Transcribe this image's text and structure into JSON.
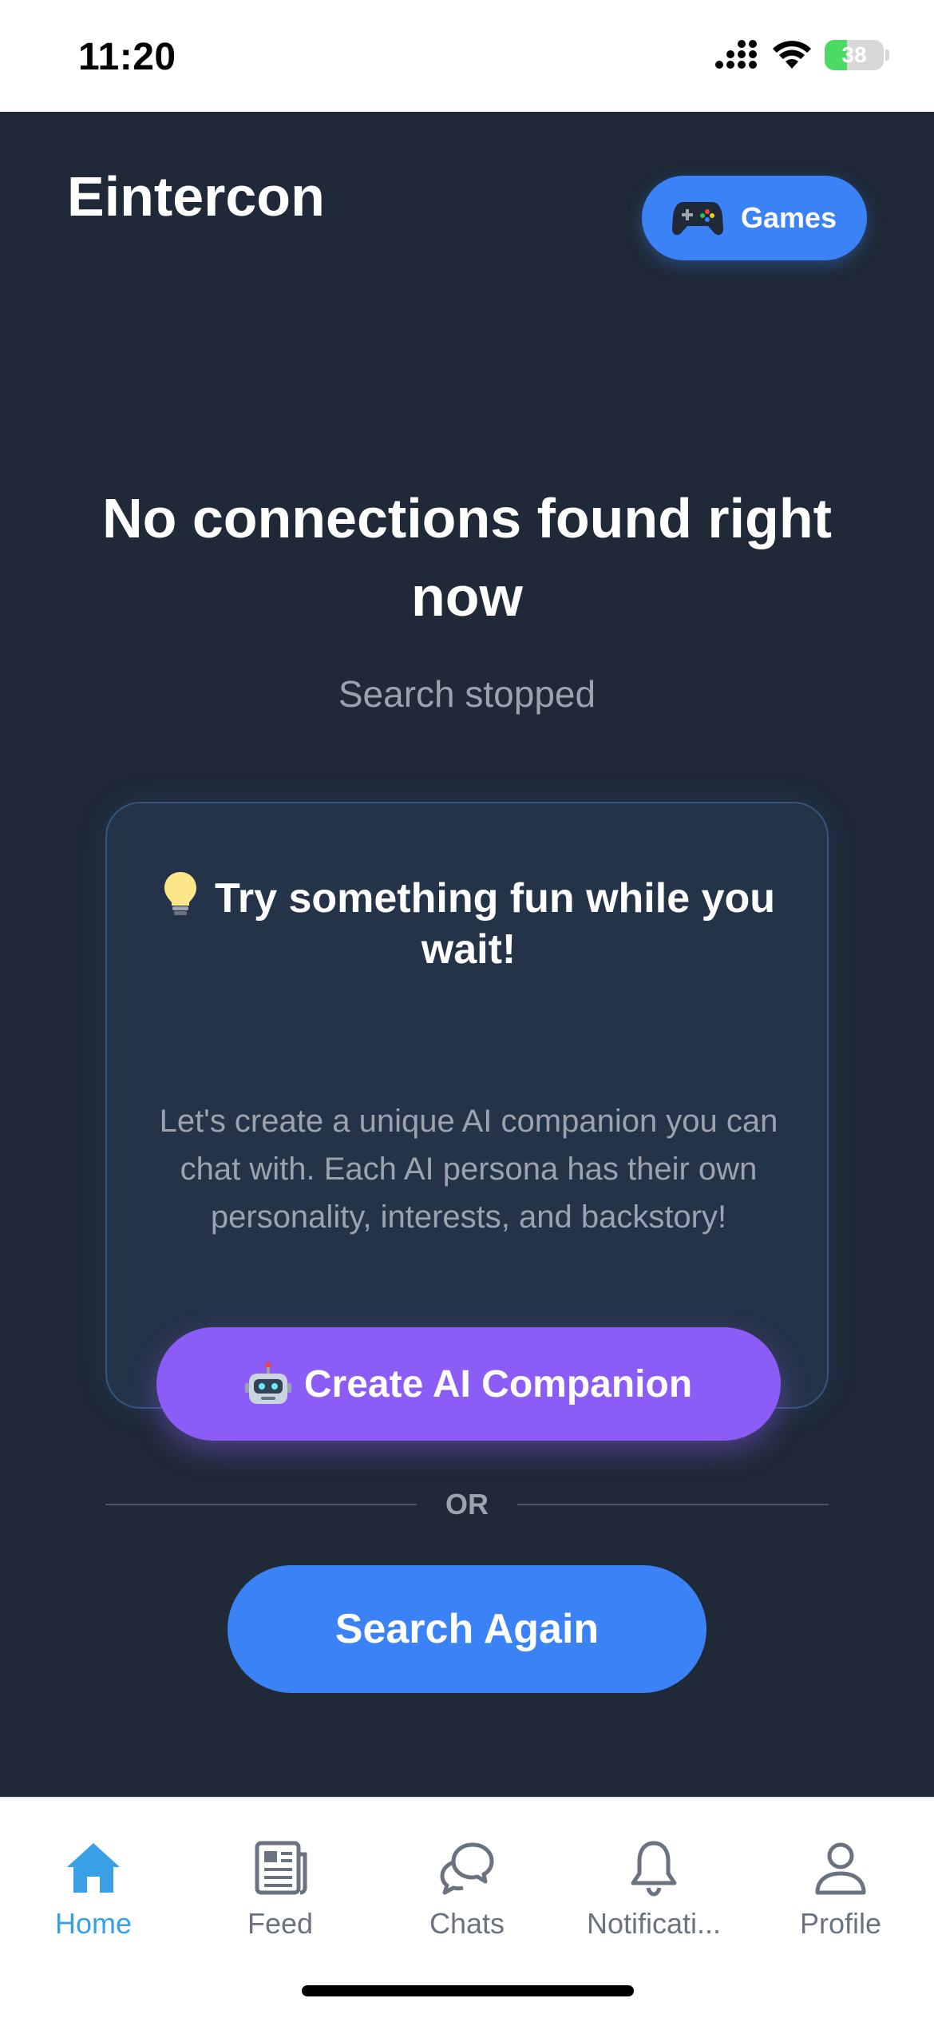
{
  "status_bar": {
    "time": "11:20",
    "battery": "38",
    "battery_level": 0.38
  },
  "header": {
    "title": "Eintercon",
    "games_button_label": "Games",
    "games_icon": "gamepad-icon"
  },
  "main": {
    "headline": "No connections found right now",
    "subline": "Search stopped",
    "card": {
      "title": "Try something fun while you wait!",
      "title_icon": "lightbulb-icon",
      "body": "Let's create a unique AI companion you can chat with. Each AI persona has their own personality, interests, and backstory!",
      "button_label": "Create AI Companion",
      "button_icon": "robot-icon"
    },
    "divider_label": "OR",
    "search_again_label": "Search Again"
  },
  "tab_bar": {
    "items": [
      {
        "label": "Home",
        "icon": "home-icon",
        "active": true
      },
      {
        "label": "Feed",
        "icon": "newspaper-icon",
        "active": false
      },
      {
        "label": "Chats",
        "icon": "chat-bubbles-icon",
        "active": false
      },
      {
        "label": "Notificati...",
        "icon": "bell-icon",
        "active": false
      },
      {
        "label": "Profile",
        "icon": "person-icon",
        "active": false
      }
    ]
  },
  "colors": {
    "background": "#1f2937",
    "card": "#253349",
    "primary_blue": "#3b82f6",
    "purple": "#8b5cf6",
    "active_tab": "#3aa0e6",
    "inactive_tab": "#6b7280"
  }
}
